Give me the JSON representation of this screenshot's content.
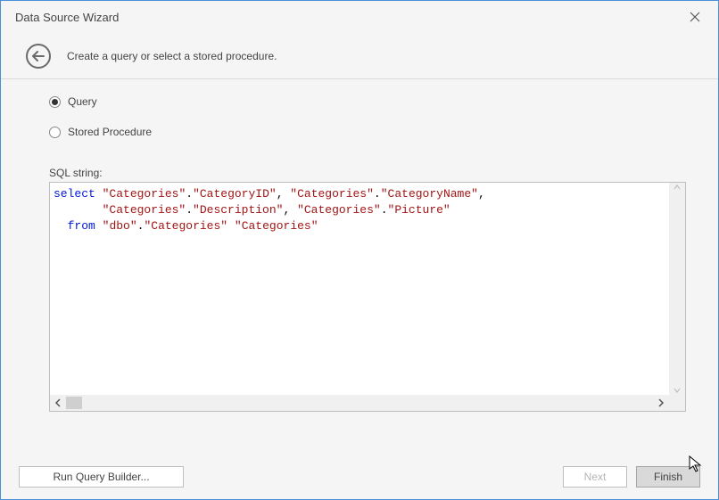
{
  "window": {
    "title": "Data Source Wizard"
  },
  "banner": {
    "instruction": "Create a query or select a stored procedure."
  },
  "options": {
    "query_label": "Query",
    "stored_proc_label": "Stored Procedure",
    "selected": "query"
  },
  "sql": {
    "label": "SQL string:",
    "tokens": [
      {
        "t": "kw",
        "v": "select"
      },
      {
        "t": "txt",
        "v": " "
      },
      {
        "t": "str",
        "v": "\"Categories\""
      },
      {
        "t": "txt",
        "v": "."
      },
      {
        "t": "str",
        "v": "\"CategoryID\""
      },
      {
        "t": "txt",
        "v": ", "
      },
      {
        "t": "str",
        "v": "\"Categories\""
      },
      {
        "t": "txt",
        "v": "."
      },
      {
        "t": "str",
        "v": "\"CategoryName\""
      },
      {
        "t": "txt",
        "v": ",\n       "
      },
      {
        "t": "str",
        "v": "\"Categories\""
      },
      {
        "t": "txt",
        "v": "."
      },
      {
        "t": "str",
        "v": "\"Description\""
      },
      {
        "t": "txt",
        "v": ", "
      },
      {
        "t": "str",
        "v": "\"Categories\""
      },
      {
        "t": "txt",
        "v": "."
      },
      {
        "t": "str",
        "v": "\"Picture\""
      },
      {
        "t": "txt",
        "v": "\n  "
      },
      {
        "t": "kw",
        "v": "from"
      },
      {
        "t": "txt",
        "v": " "
      },
      {
        "t": "str",
        "v": "\"dbo\""
      },
      {
        "t": "txt",
        "v": "."
      },
      {
        "t": "str",
        "v": "\"Categories\""
      },
      {
        "t": "txt",
        "v": " "
      },
      {
        "t": "str",
        "v": "\"Categories\""
      }
    ]
  },
  "buttons": {
    "run_query_builder": "Run Query Builder...",
    "next": "Next",
    "finish": "Finish"
  }
}
